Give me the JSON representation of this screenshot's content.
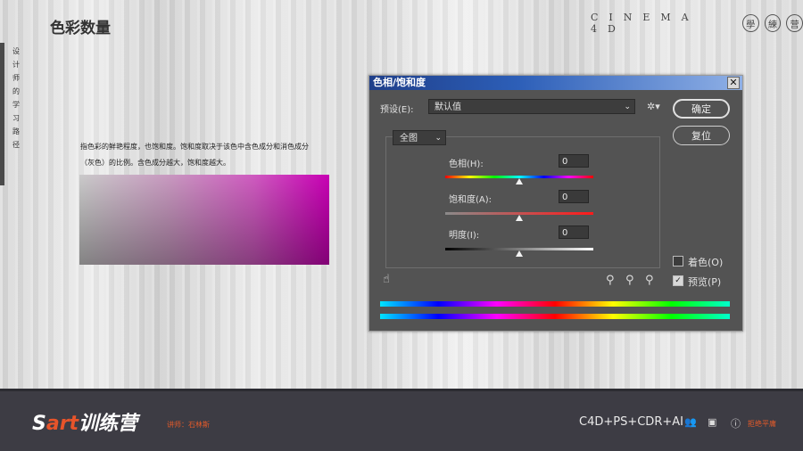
{
  "page": {
    "title": "色彩数量",
    "brand": "CINEMA 4D",
    "brand_circles": [
      "學",
      "練",
      "营"
    ],
    "sidebar_text": [
      "设",
      "计",
      "师",
      "的",
      "学",
      "习",
      "路",
      "径"
    ],
    "description": "指色彩的鲜艳程度，也饱和度。饱和度取决于该色中含色成分和消色成分（灰色）的比例。含色成分越大，饱和度越大。"
  },
  "dialog": {
    "title": "色相/饱和度",
    "close": "✕",
    "preset_label": "预设(E):",
    "preset_value": "默认值",
    "ok": "确定",
    "reset": "复位",
    "channel": "全图",
    "sliders": [
      {
        "label": "色相(H):",
        "value": "0",
        "level": 0.5
      },
      {
        "label": "饱和度(A):",
        "value": "0",
        "level": 0.5
      },
      {
        "label": "明度(I):",
        "value": "0",
        "level": 0.5
      }
    ],
    "colorize_label": "着色(O)",
    "colorize_checked": false,
    "preview_label": "预览(P)",
    "preview_checked": true
  },
  "footer": {
    "logo_s": "S",
    "logo_art": "art",
    "logo_cn": "训练营",
    "teacher": "讲师：石林斯",
    "courses": "C4D+PS+CDR+AI",
    "note": "拒绝平庸"
  },
  "colors": {
    "accent": "#e25a2a",
    "dialog_bg": "#535353",
    "footer_bg": "#3d3c44"
  }
}
